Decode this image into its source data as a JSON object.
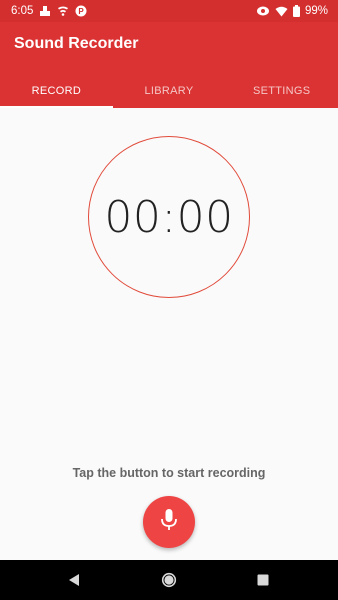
{
  "status_bar": {
    "time": "6:05",
    "battery": "99%",
    "icons": [
      "notification-icon",
      "cast-icon",
      "parking-icon",
      "data-saver-icon",
      "wifi-icon",
      "battery-icon"
    ]
  },
  "app": {
    "title": "Sound Recorder"
  },
  "tabs": [
    {
      "label": "RECORD",
      "active": true
    },
    {
      "label": "LIBRARY",
      "active": false
    },
    {
      "label": "SETTINGS",
      "active": false
    }
  ],
  "timer": {
    "value": "00:00"
  },
  "hint": "Tap the button to start recording",
  "colors": {
    "app_bar": "#db3333",
    "status_bar": "#d32f2f",
    "accent": "#ef4444",
    "circle": "#e14b3b"
  },
  "nav": {
    "icons": [
      "back-icon",
      "home-icon",
      "recents-icon"
    ]
  }
}
